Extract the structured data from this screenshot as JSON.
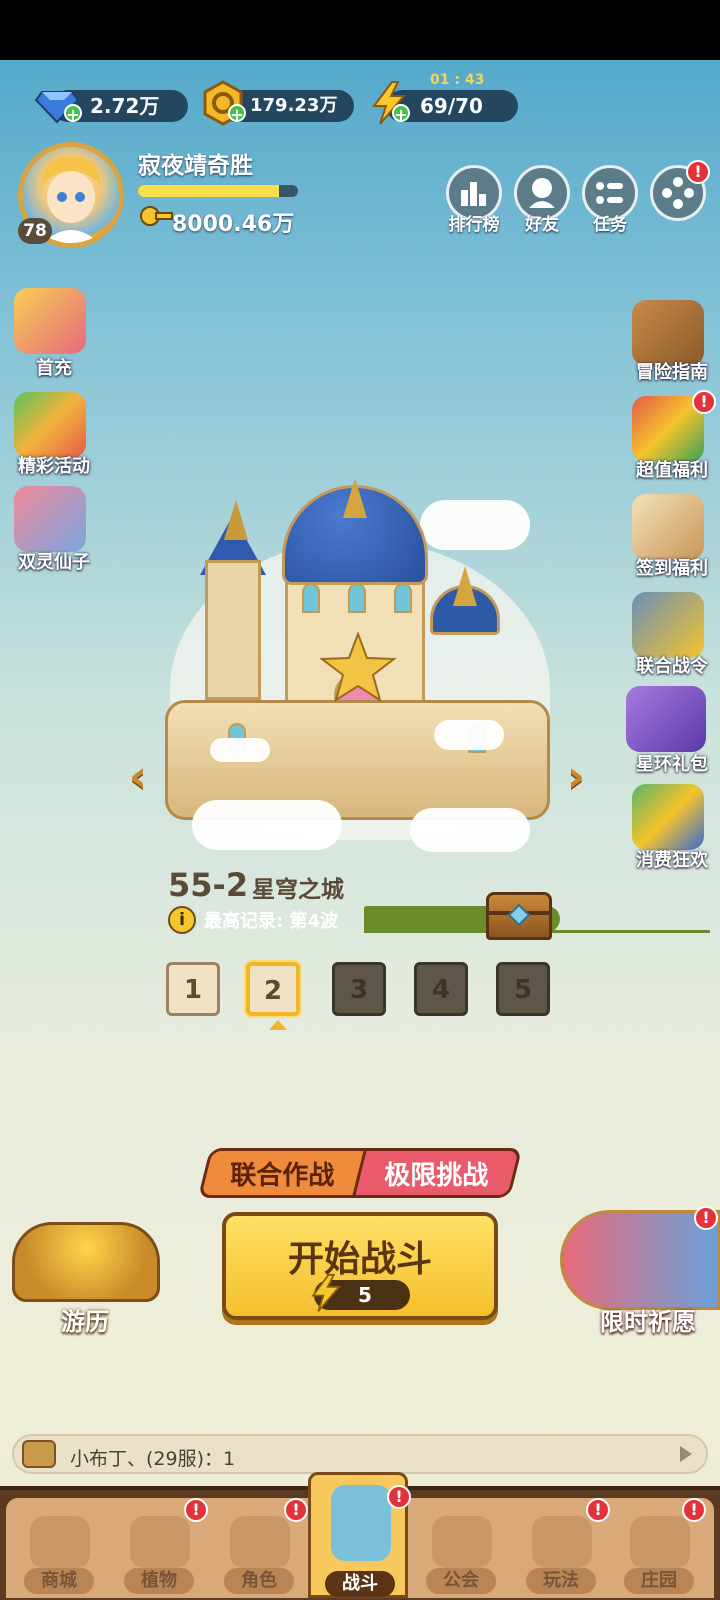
{
  "resources": {
    "diamonds": "2.72万",
    "coins": "179.23万",
    "energy_timer": "01 : 43",
    "energy": "69/70"
  },
  "player": {
    "name": "寂夜靖奇胜",
    "level": "78",
    "exp_fraction": 0.88,
    "gold": "8000.46万"
  },
  "top_buttons": [
    "排行榜",
    "好友",
    "任务"
  ],
  "left_menu": [
    "首充",
    "精彩活动",
    "双灵仙子"
  ],
  "right_menu": [
    "冒险指南",
    "超值福利",
    "签到福利",
    "联合战令",
    "星环礼包",
    "消费狂欢"
  ],
  "badge": "!",
  "stage": {
    "number": "55-2",
    "name": "星穹之城",
    "record_icon": "i",
    "record": "最高记录: 第4波",
    "levels": [
      "1",
      "2",
      "3",
      "4",
      "5"
    ],
    "nav_prev": "‹",
    "nav_next": "›"
  },
  "modes": {
    "coop": "联合作战",
    "limit": "极限挑战"
  },
  "start": {
    "label": "开始战斗",
    "cost": "5"
  },
  "side_actions": {
    "travel": "游历",
    "wish": "限时祈愿"
  },
  "chat": {
    "message": "小布丁、(29服)：1"
  },
  "nav": [
    "商城",
    "植物",
    "角色",
    "战斗",
    "公会",
    "玩法",
    "庄园"
  ],
  "colors": {
    "accent_gold": "#f5bf2c",
    "badge_red": "#e4323a",
    "nav_bg": "#d9a97a"
  }
}
